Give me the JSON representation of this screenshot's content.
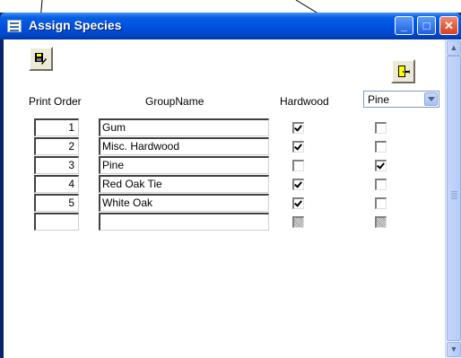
{
  "window": {
    "title": "Assign Species"
  },
  "titlebar_buttons": {
    "minimize": "_",
    "maximize": "□",
    "close": "✕"
  },
  "toolbar": {
    "save_icon": "save-edit-icon",
    "exit_icon": "exit-door-icon"
  },
  "headers": {
    "print_order": "Print Order",
    "group_name": "GroupName",
    "hardwood": "Hardwood"
  },
  "species_select": {
    "value": "Pine"
  },
  "rows": [
    {
      "order": "1",
      "name": "Gum",
      "hardwood": true,
      "species": false
    },
    {
      "order": "2",
      "name": "Misc. Hardwood",
      "hardwood": true,
      "species": false
    },
    {
      "order": "3",
      "name": "Pine",
      "hardwood": false,
      "species": true
    },
    {
      "order": "4",
      "name": "Red Oak Tie",
      "hardwood": true,
      "species": false
    },
    {
      "order": "5",
      "name": "White Oak",
      "hardwood": true,
      "species": false
    },
    {
      "order": "",
      "name": "",
      "hardwood": null,
      "species": null
    }
  ]
}
